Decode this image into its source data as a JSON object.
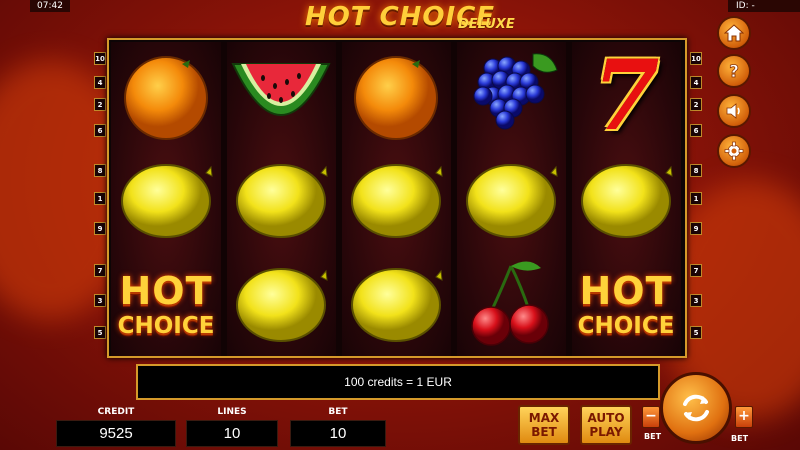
{
  "status": {
    "time": "07:42",
    "id_label": "ID: -"
  },
  "logo": {
    "title": "HOT CHOICE",
    "subtitle": "DELUXE"
  },
  "reels": [
    [
      "orange",
      "lemon",
      "hot-choice"
    ],
    [
      "watermelon",
      "lemon",
      "lemon"
    ],
    [
      "orange",
      "lemon",
      "lemon"
    ],
    [
      "grapes",
      "lemon",
      "cherries"
    ],
    [
      "seven",
      "lemon",
      "hot-choice"
    ]
  ],
  "hot_choice_symbol": {
    "line1": "HOT",
    "line2": "CHOICE"
  },
  "seven_symbol": {
    "text": "7"
  },
  "paylines": {
    "left": [
      "10",
      "4",
      "2",
      "6",
      "8",
      "1",
      "9",
      "7",
      "3",
      "5"
    ],
    "right": [
      "10",
      "4",
      "2",
      "6",
      "8",
      "1",
      "9",
      "7",
      "3",
      "5"
    ]
  },
  "info_bar": {
    "text": "100 credits = 1 EUR"
  },
  "credit": {
    "label": "CREDIT",
    "value": "9525"
  },
  "lines": {
    "label": "LINES",
    "value": "10"
  },
  "bet": {
    "label": "BET",
    "value": "10"
  },
  "buttons": {
    "max_bet": {
      "line1": "MAX",
      "line2": "BET"
    },
    "auto_play": {
      "line1": "AUTO",
      "line2": "PLAY"
    },
    "bet_minus": {
      "symbol": "−",
      "label": "BET"
    },
    "bet_plus": {
      "symbol": "+",
      "label": "BET"
    }
  },
  "side_buttons": [
    "home-icon",
    "help-icon",
    "sound-icon",
    "settings-icon"
  ],
  "colors": {
    "accent": "#d59a2a",
    "background": "#8c1408",
    "button": "#f0a020"
  }
}
